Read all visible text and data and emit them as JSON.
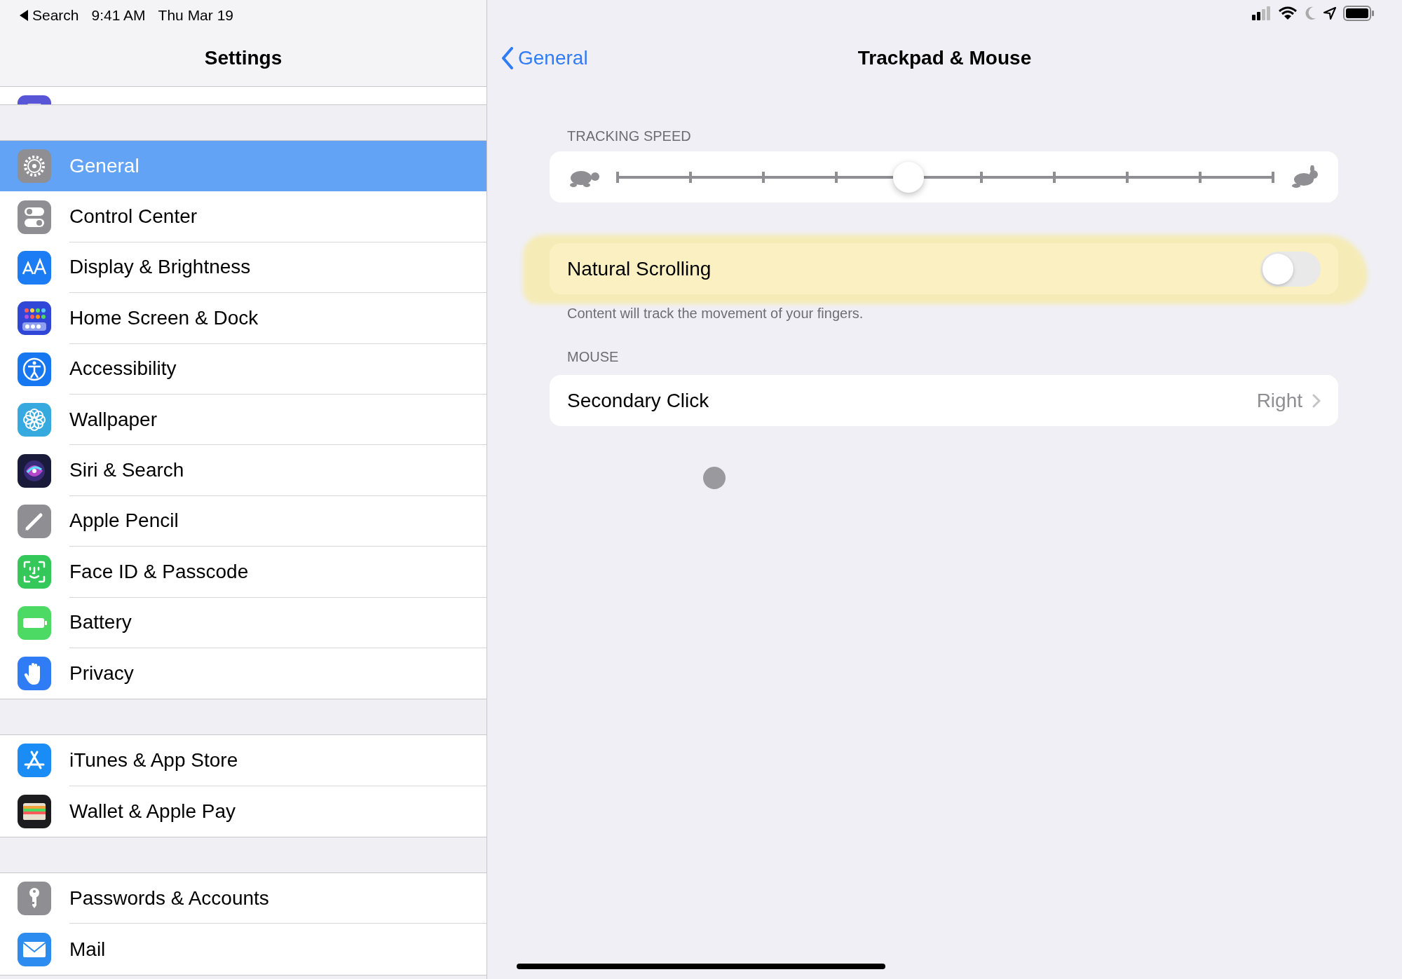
{
  "status_bar": {
    "back_app": "Search",
    "time": "9:41 AM",
    "date": "Thu Mar 19"
  },
  "sidebar": {
    "title": "Settings",
    "groups": [
      {
        "items": [
          {
            "label": "General",
            "selected": true
          },
          {
            "label": "Control Center",
            "selected": false
          },
          {
            "label": "Display & Brightness",
            "selected": false
          },
          {
            "label": "Home Screen & Dock",
            "selected": false
          },
          {
            "label": "Accessibility",
            "selected": false
          },
          {
            "label": "Wallpaper",
            "selected": false
          },
          {
            "label": "Siri & Search",
            "selected": false
          },
          {
            "label": "Apple Pencil",
            "selected": false
          },
          {
            "label": "Face ID & Passcode",
            "selected": false
          },
          {
            "label": "Battery",
            "selected": false
          },
          {
            "label": "Privacy",
            "selected": false
          }
        ]
      },
      {
        "items": [
          {
            "label": "iTunes & App Store",
            "selected": false
          },
          {
            "label": "Wallet & Apple Pay",
            "selected": false
          }
        ]
      },
      {
        "items": [
          {
            "label": "Passwords & Accounts",
            "selected": false
          },
          {
            "label": "Mail",
            "selected": false
          }
        ]
      }
    ]
  },
  "detail": {
    "back": "General",
    "title": "Trackpad & Mouse",
    "tracking_speed": {
      "header": "TRACKING SPEED",
      "level": 0.444
    },
    "natural_scrolling": {
      "label": "Natural Scrolling",
      "on": false,
      "highlighted": true,
      "footer": "Content will track the movement of your fingers."
    },
    "mouse": {
      "header": "MOUSE",
      "rows": [
        {
          "label": "Secondary Click",
          "value": "Right"
        }
      ]
    }
  }
}
